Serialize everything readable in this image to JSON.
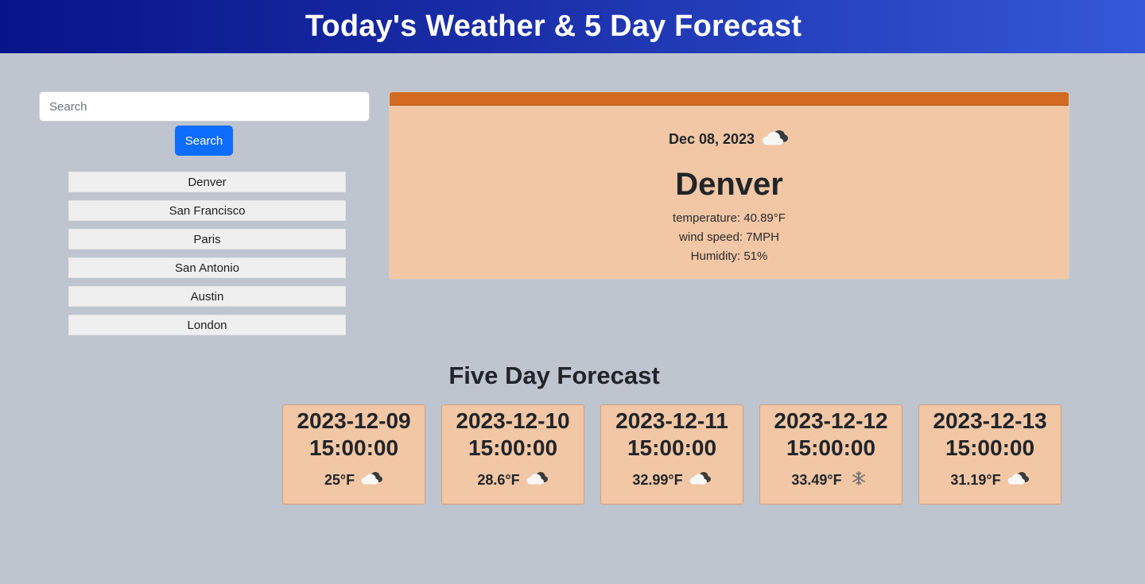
{
  "header": {
    "title": "Today's Weather & 5 Day Forecast"
  },
  "search": {
    "placeholder": "Search",
    "value": "",
    "button_label": "Search"
  },
  "history": [
    "Denver",
    "San Francisco",
    "Paris",
    "San Antonio",
    "Austin",
    "London"
  ],
  "current": {
    "date": "Dec 08, 2023",
    "icon": "cloudy-icon",
    "city": "Denver",
    "temperature": "temperature: 40.89°F",
    "wind": "wind speed: 7MPH",
    "humidity": "Humidity: 51%"
  },
  "forecast": {
    "title": "Five Day Forecast",
    "days": [
      {
        "date": "2023-12-09 15:00:00",
        "temp": "25°F",
        "icon": "cloudy-icon"
      },
      {
        "date": "2023-12-10 15:00:00",
        "temp": "28.6°F",
        "icon": "cloudy-icon"
      },
      {
        "date": "2023-12-11 15:00:00",
        "temp": "32.99°F",
        "icon": "cloudy-icon"
      },
      {
        "date": "2023-12-12 15:00:00",
        "temp": "33.49°F",
        "icon": "snow-icon"
      },
      {
        "date": "2023-12-13 15:00:00",
        "temp": "31.19°F",
        "icon": "cloudy-icon"
      }
    ]
  },
  "colors": {
    "background": "#bec5ce",
    "header_start": "#071389",
    "header_end": "#3458d8",
    "card": "#f2c7a6",
    "card_top": "#d26b21",
    "button": "#0d6efd"
  }
}
